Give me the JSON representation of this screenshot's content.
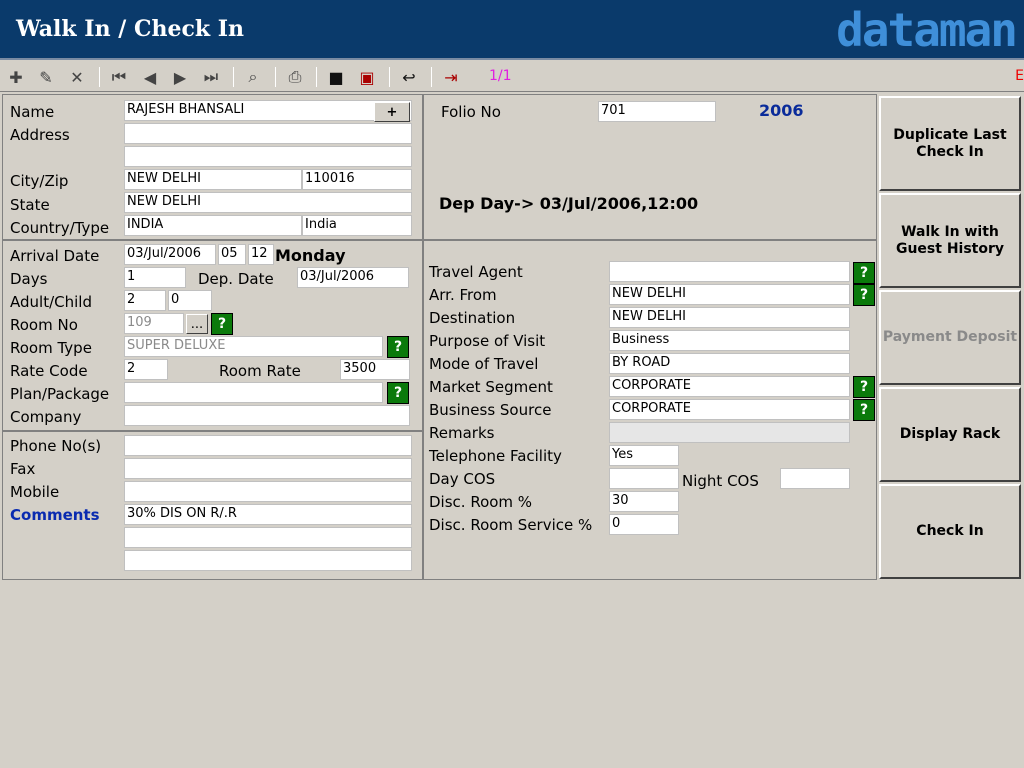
{
  "header": {
    "title": "Walk In / Check In",
    "logo": "dataman"
  },
  "toolbar": {
    "icons": [
      "add-icon",
      "edit-icon",
      "delete-icon",
      "first-icon",
      "prev-icon",
      "next-icon",
      "last-icon",
      "find-icon",
      "print-icon",
      "save-icon",
      "cancel-save-icon",
      "undo-icon",
      "exit-icon"
    ],
    "record_position": "1/1",
    "edge_text": "E"
  },
  "guest": {
    "labels": {
      "name": "Name",
      "address": "Address",
      "city_zip": "City/Zip",
      "state": "State",
      "country_type": "Country/Type"
    },
    "name": "RAJESH BHANSALI",
    "add_button": "+",
    "address1": "",
    "address2": "",
    "city": "NEW DELHI",
    "zip": "110016",
    "state": "NEW DELHI",
    "country": "INDIA",
    "type": "India"
  },
  "folio": {
    "label": "Folio No",
    "value": "701",
    "year": "2006",
    "dep_day": "Dep Day-> 03/Jul/2006,12:00"
  },
  "stay": {
    "labels": {
      "arrival": "Arrival Date",
      "days": "Days",
      "dep_date": "Dep. Date",
      "adult_child": "Adult/Child",
      "room_no": "Room No",
      "room_type": "Room Type",
      "rate_code": "Rate Code",
      "room_rate": "Room Rate",
      "plan": "Plan/Package",
      "company": "Company"
    },
    "arrival_date": "03/Jul/2006",
    "arrival_hour": "05",
    "arrival_min": "12",
    "weekday": "Monday",
    "days": "1",
    "dep_date": "03/Jul/2006",
    "adults": "2",
    "children": "0",
    "room_no": "109",
    "browse_button": "...",
    "room_type": "SUPER DELUXE",
    "rate_code": "2",
    "room_rate": "3500",
    "plan": "",
    "company": ""
  },
  "visit": {
    "labels": {
      "travel_agent": "Travel Agent",
      "arr_from": "Arr. From",
      "destination": "Destination",
      "purpose": "Purpose of Visit",
      "mode": "Mode of Travel",
      "market": "Market Segment",
      "business_source": "Business Source",
      "remarks": "Remarks",
      "telephone": "Telephone Facility",
      "day_cos": "Day COS",
      "night_cos": "Night COS",
      "disc_room": "Disc. Room %",
      "disc_service": "Disc. Room Service %"
    },
    "travel_agent": "",
    "arr_from": "NEW DELHI",
    "destination": "NEW DELHI",
    "purpose": "Business",
    "mode": "BY ROAD",
    "market": "CORPORATE",
    "business_source": "CORPORATE",
    "remarks": "",
    "telephone": "Yes",
    "day_cos": "",
    "night_cos": "",
    "disc_room": "30",
    "disc_service": "0"
  },
  "contact": {
    "labels": {
      "phone": "Phone No(s)",
      "fax": "Fax",
      "mobile": "Mobile",
      "comments": "Comments"
    },
    "phone": "",
    "fax": "",
    "mobile": "",
    "comments": "30% DIS ON R/.R",
    "comments2": "",
    "comments3": ""
  },
  "help_glyph": "?",
  "actions": {
    "duplicate": "Duplicate Last Check In",
    "walkin_history": "Walk In with Guest History",
    "payment_deposit": "Payment Deposit",
    "display_rack": "Display Rack",
    "check_in": "Check In"
  }
}
